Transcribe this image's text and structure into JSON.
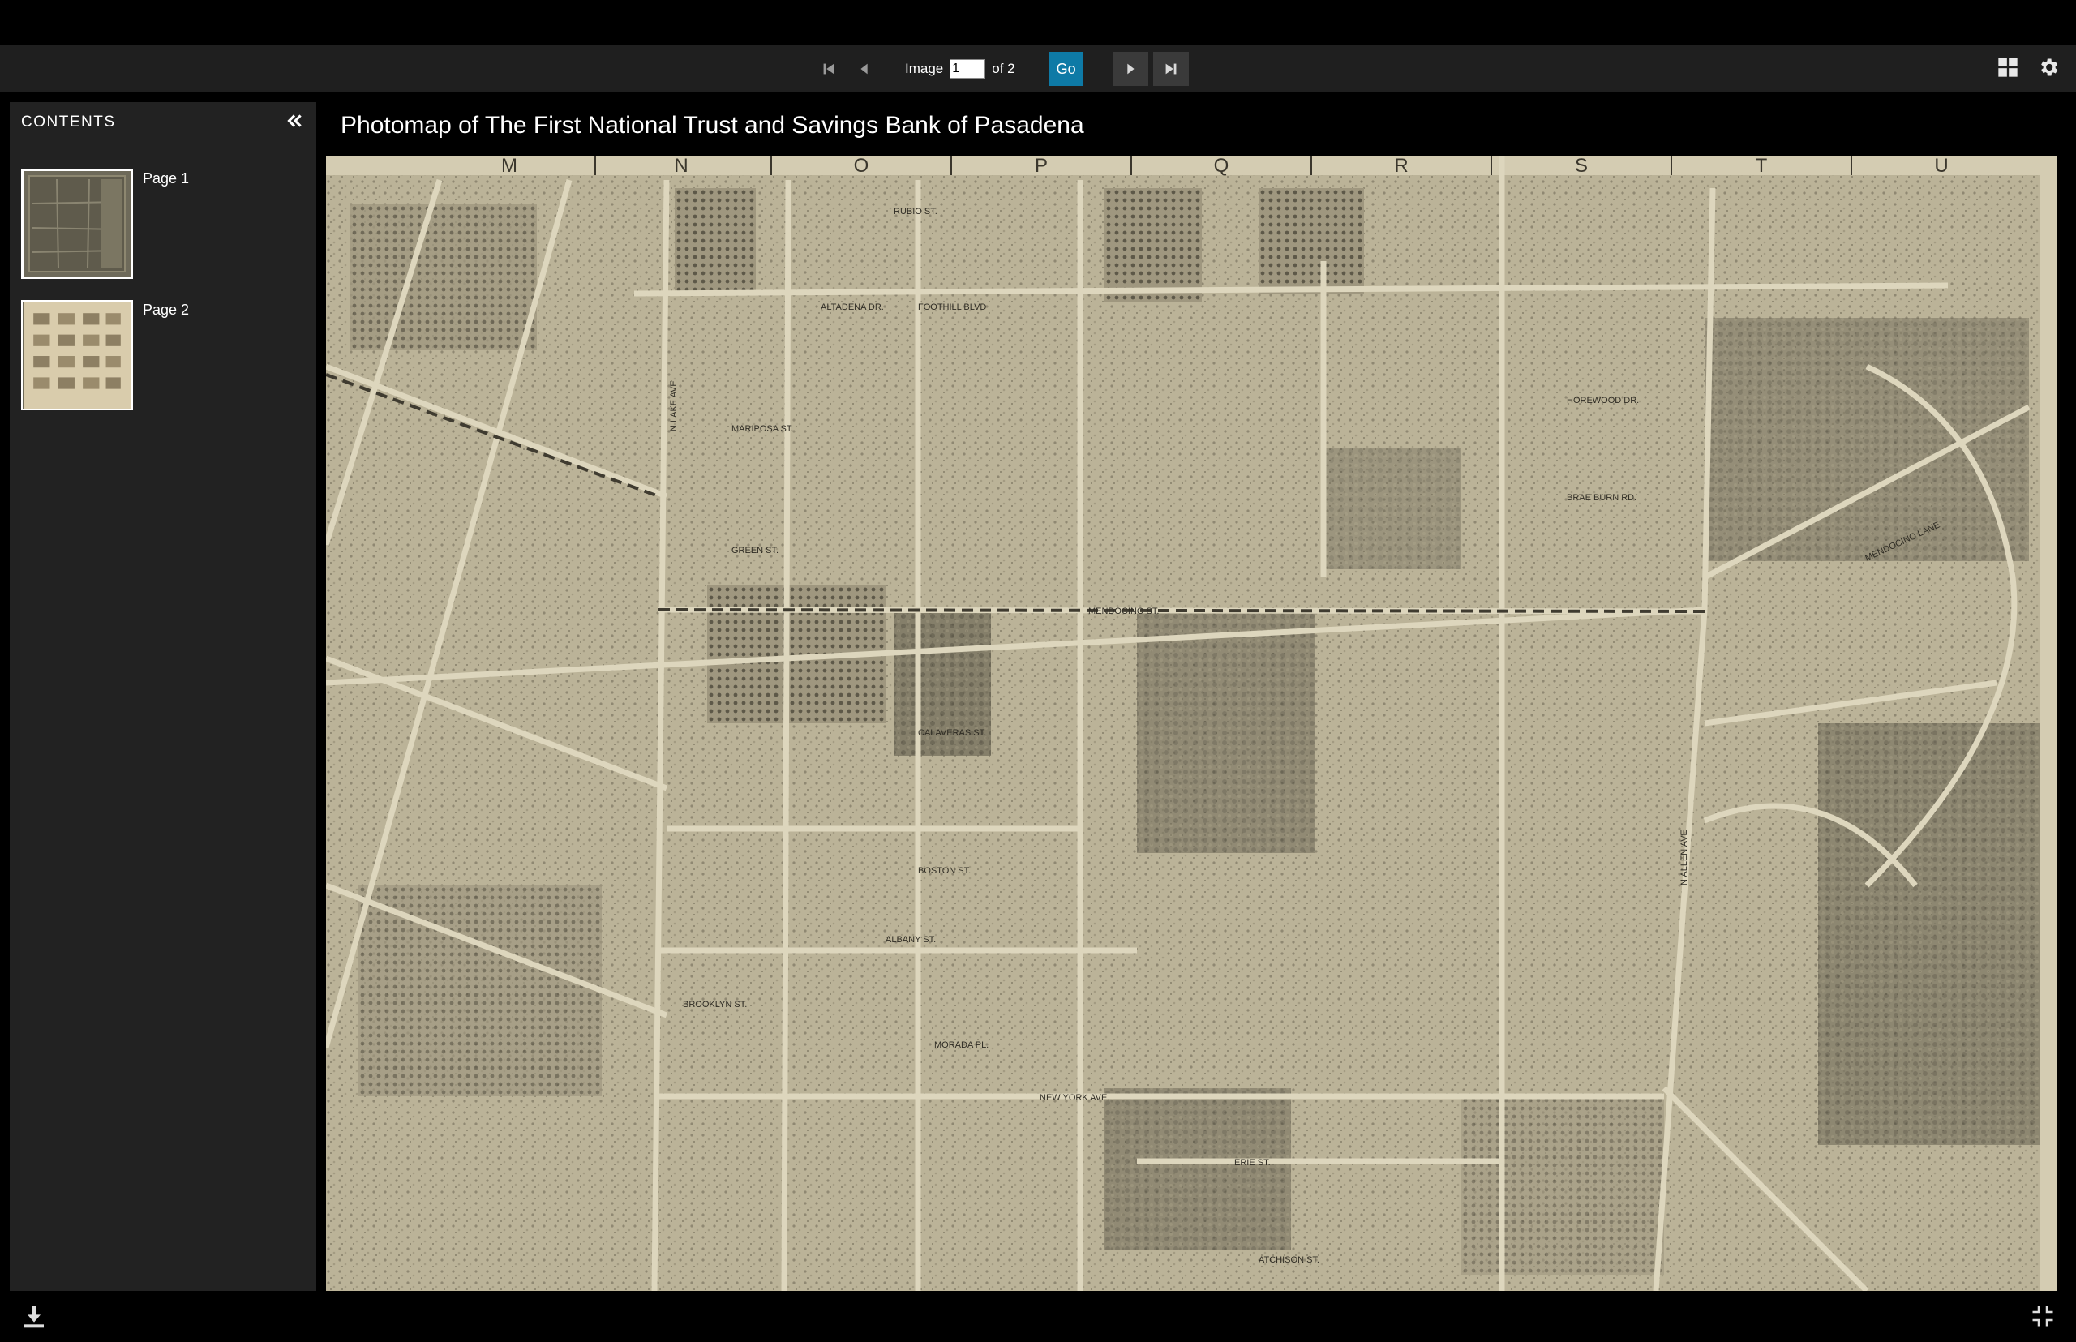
{
  "toolbar": {
    "image_label": "Image",
    "current_page": "1",
    "of_label": "of 2",
    "go_label": "Go",
    "icons": {
      "first": "first-page-icon",
      "prev": "previous-page-icon",
      "next": "next-page-icon",
      "last": "last-page-icon",
      "grid": "grid-view-icon",
      "settings": "gear-icon"
    }
  },
  "sidebar": {
    "title": "CONTENTS",
    "pages": [
      {
        "label": "Page 1",
        "selected": true
      },
      {
        "label": "Page 2",
        "selected": false
      }
    ]
  },
  "viewer": {
    "title": "Photomap of The First National Trust and Savings Bank of Pasadena",
    "grid_letters": [
      "M",
      "N",
      "O",
      "P",
      "Q",
      "R",
      "S",
      "T",
      "U"
    ],
    "street_labels": [
      "RUBIO ST.",
      "ALTADENA DR.",
      "FOOTHILL BLVD",
      "MARIPOSA ST.",
      "GREEN ST.",
      "MENDOCINO ST.",
      "CALAVERAS ST.",
      "BOSTON ST.",
      "ALBANY ST.",
      "BROOKLYN ST.",
      "MORADA PL.",
      "NEW YORK AVE.",
      "ERIE ST.",
      "ATCHISON ST.",
      "HOREWOOD DR.",
      "BRAE BURN RD.",
      "MENDOCINO LANE",
      "N LAKE AVE",
      "N ALLEN AVE"
    ]
  },
  "colors": {
    "toolbar_bg": "#1f1f1f",
    "go_button": "#0e7aa6",
    "sidebar_bg": "#222222",
    "map_paper": "#bdb59a"
  }
}
